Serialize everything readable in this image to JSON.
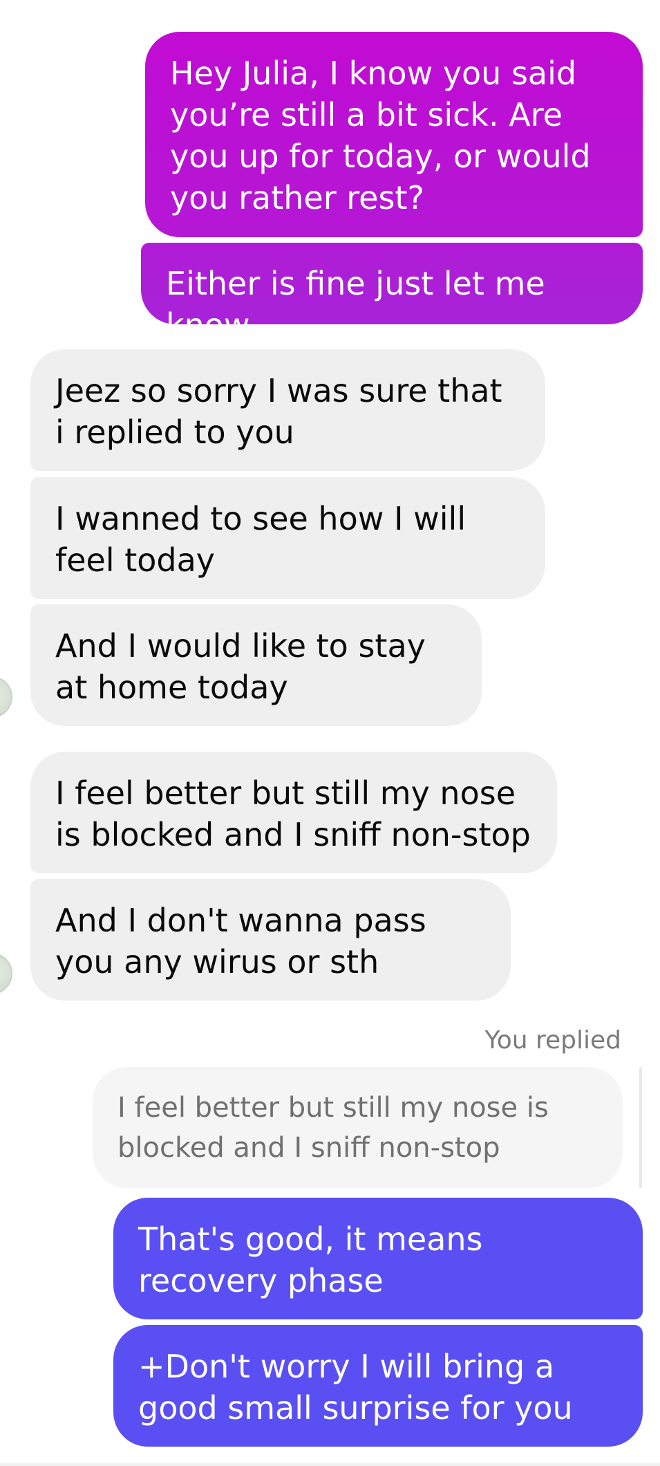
{
  "conversation": {
    "messages": [
      {
        "text": "Hey Julia, I know you said you’re still a bit sick. Are you up for today, or would you rather rest?"
      },
      {
        "text": "Either is fine just let me know"
      },
      {
        "text": "Jeez so sorry I was sure that i replied to you"
      },
      {
        "text": "I wanned to see how I will feel today"
      },
      {
        "text": "And I would like to stay at home today"
      },
      {
        "text": "I feel better but still my nose is blocked and I sniff non-stop"
      },
      {
        "text": "And I don't wanna pass you any wirus or sth"
      },
      {
        "text": "That's good, it means recovery phase"
      },
      {
        "text": "+Don't worry I will bring a good small surprise for you"
      }
    ],
    "reply_label": "You replied",
    "quoted_text": "I feel better but still my nose is blocked and I sniff non-stop"
  },
  "colors": {
    "sent_gradient_top": "#c10bd3",
    "sent_gradient_bottom": "#a623d8",
    "sent_blue": "#5a4ff3",
    "received_bubble": "#efefef",
    "quote_bubble": "#f5f5f5"
  },
  "icons": {
    "avatar": "avatar-icon"
  }
}
